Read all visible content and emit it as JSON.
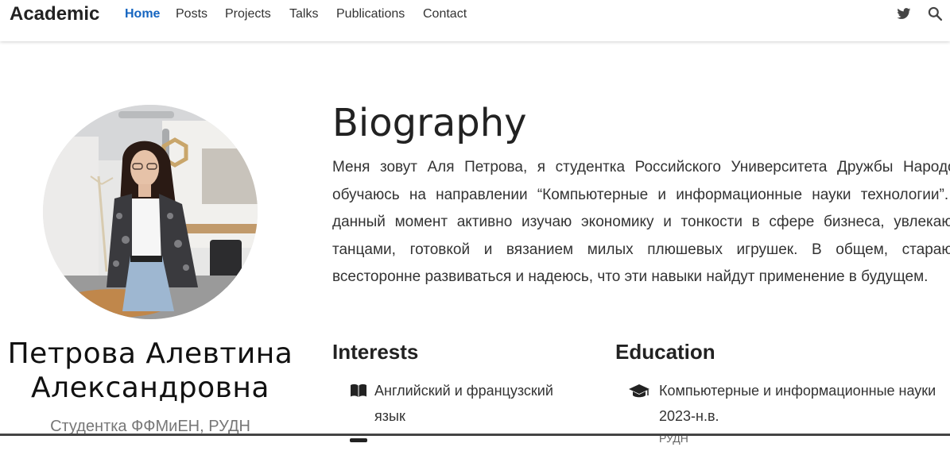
{
  "navbar": {
    "brand": "Academic",
    "links": [
      {
        "label": "Home",
        "active": true
      },
      {
        "label": "Posts",
        "active": false
      },
      {
        "label": "Projects",
        "active": false
      },
      {
        "label": "Talks",
        "active": false
      },
      {
        "label": "Publications",
        "active": false
      },
      {
        "label": "Contact",
        "active": false
      }
    ],
    "icons": [
      "twitter-icon",
      "search-icon"
    ],
    "active_color": "#1565c0"
  },
  "profile": {
    "name_line1": "Петрова Алевтина",
    "name_line2": "Александровна",
    "role": "Студентка ФФМиЕН, РУДН"
  },
  "biography": {
    "title": "Biography",
    "text": "Меня зовут Аля Петрова, я студентка Российского Университета Дружбы Народов, обучаюсь на направлении “Компьютерные и информационные науки технологии”. В данный момент активно изучаю экономику и тонкости в сфере бизнеса, увлекаюсь танцами, готовкой и вязанием милых плюшевых игрушек. В общем, стараюсь всесторонне развиваться и надеюсь, что эти навыки найдут применение в будущем."
  },
  "interests": {
    "title": "Interests",
    "items": [
      "Английский и французский язык"
    ]
  },
  "education": {
    "title": "Education",
    "items": [
      {
        "course": "Компьютерные и информационные науки",
        "years": "2023-н.в.",
        "institution": "РУДН"
      }
    ]
  }
}
